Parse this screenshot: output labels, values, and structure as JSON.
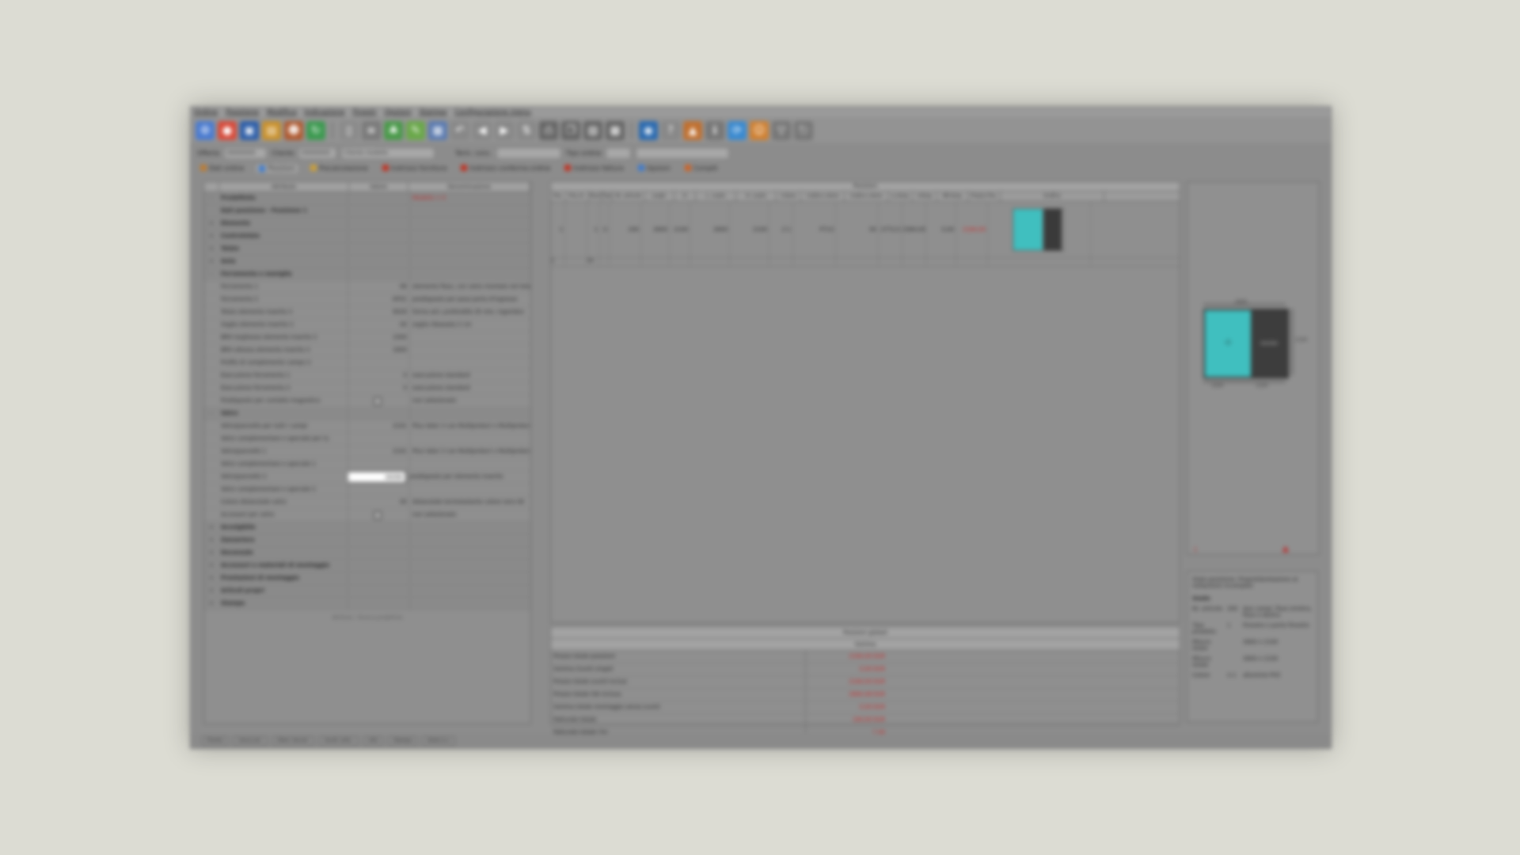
{
  "menu": [
    "Ordine",
    "Posizione",
    "Modifica",
    "Indicazione",
    "Finestr",
    "Opzioni",
    "Stampa",
    "Configurazione menu"
  ],
  "header": {
    "offerta_label": "Offerta",
    "offerta_value": "00000000",
    "cliente_label": "Cliente",
    "cliente_id": "00000000",
    "cliente_name": "Cliente modello",
    "term_label": "Term. cons.",
    "tipo_label": "Tipo ordine"
  },
  "tabs": [
    "Dati ordine",
    "Posizioni",
    "Precalcolazione",
    "Indirizzo fornitura",
    "Indirizzo conferma ordine",
    "Indirizzo fattura",
    "Opzioni",
    "Compiti"
  ],
  "left_grid": {
    "headers": [
      "Attributo",
      "Valore",
      "Denominazione"
    ],
    "rows": [
      {
        "t": "group",
        "exp": "-",
        "name": "Predefinito",
        "val": "",
        "den": "Modello = 0"
      },
      {
        "t": "group",
        "exp": "",
        "name": "Dati posizione - Posizione 1",
        "val": "",
        "den": ""
      },
      {
        "t": "group",
        "exp": "+",
        "name": "Elemento",
        "val": "",
        "den": ""
      },
      {
        "t": "group",
        "exp": "+",
        "name": "Controtelaio",
        "val": "",
        "den": ""
      },
      {
        "t": "group",
        "exp": "+",
        "name": "Telaio",
        "val": "",
        "den": ""
      },
      {
        "t": "group",
        "exp": "+",
        "name": "Anta",
        "val": "",
        "den": ""
      },
      {
        "t": "group",
        "exp": "-",
        "name": "Ferramenta e maniglia",
        "val": "",
        "den": ""
      },
      {
        "t": "row",
        "exp": "",
        "name": "Ferramenta 1",
        "val": "99",
        "den": "elemento fisso, con vetro montato nel telaio"
      },
      {
        "t": "row",
        "exp": "",
        "name": "Ferramenta 2",
        "val": "HF01",
        "den": "predisposto per posa porta d'ingresso"
      },
      {
        "t": "row",
        "exp": "",
        "name": "Telaio elemento inserito 2",
        "val": "9029",
        "den": "forma ad L profondità 35 mm, ingombro"
      },
      {
        "t": "row",
        "exp": "",
        "name": "Soglia elemento inserito 2",
        "val": "00",
        "den": "soglia ribassata 2 cm"
      },
      {
        "t": "row",
        "exp": "",
        "name": "BRH larghezza elemento inserito 2",
        "val": "1000",
        "den": ""
      },
      {
        "t": "row",
        "exp": "",
        "name": "BRH altezza elemento inserito 2",
        "val": "1600",
        "den": ""
      },
      {
        "t": "row",
        "exp": "",
        "name": "Profilo di complemento campo 2",
        "val": "",
        "den": ""
      },
      {
        "t": "row",
        "exp": "",
        "name": "Esecuzione ferramenta 1",
        "val": "0",
        "den": "esecuzione standard"
      },
      {
        "t": "row",
        "exp": "",
        "name": "Esecuzione ferramenta 2",
        "val": "0",
        "den": "esecuzione standard"
      },
      {
        "t": "check",
        "exp": "",
        "name": "Predisposto per contatto magnetico",
        "val": "",
        "den": "non selezionato"
      },
      {
        "t": "group",
        "exp": "-",
        "name": "Vetro",
        "val": "",
        "den": ""
      },
      {
        "t": "row",
        "exp": "",
        "name": "Vetro/pannello per tutti i campi",
        "val": "2101",
        "den": "Plus Valor 2 con Multiprotect x Multiprotect"
      },
      {
        "t": "row",
        "exp": "",
        "name": "Vetro complementare o speciale per tu",
        "val": "",
        "den": ""
      },
      {
        "t": "row",
        "exp": "",
        "name": "Vetro/pannello 1",
        "val": "2101",
        "den": "Plus Valor 2 con Multiprotect x Multiprotect"
      },
      {
        "t": "row",
        "exp": "",
        "name": "Vetro complementare o speciale 1",
        "val": "",
        "den": ""
      },
      {
        "t": "edit",
        "exp": "",
        "name": "Vetro/pannello 2",
        "val": "00090",
        "den": "predisposto per elemento inserito"
      },
      {
        "t": "row",
        "exp": "",
        "name": "Vetro complementare o speciale 2",
        "val": "",
        "den": ""
      },
      {
        "t": "row",
        "exp": "",
        "name": "Colore distanziale vetro",
        "val": "00",
        "den": "distanziale termoisolante colore nero 00"
      },
      {
        "t": "check",
        "exp": "",
        "name": "Accessori per vetro",
        "val": "",
        "den": "non selezionato"
      },
      {
        "t": "group",
        "exp": "+",
        "name": "Avvolgibile",
        "val": "",
        "den": ""
      },
      {
        "t": "group",
        "exp": "+",
        "name": "Zanzariera",
        "val": "",
        "den": ""
      },
      {
        "t": "group",
        "exp": "+",
        "name": "Davanzale",
        "val": "",
        "den": ""
      },
      {
        "t": "group",
        "exp": "+",
        "name": "Accessori e materiali di montaggio",
        "val": "",
        "den": ""
      },
      {
        "t": "group",
        "exp": "+",
        "name": "Prestazioni di montaggio",
        "val": "",
        "den": ""
      },
      {
        "t": "group",
        "exp": "+",
        "name": "Articoli propri",
        "val": "",
        "den": ""
      },
      {
        "t": "group",
        "exp": "+",
        "name": "Stampa",
        "val": "",
        "den": ""
      }
    ],
    "footer": "Attributo - Ricerca predefinita"
  },
  "positions": {
    "title": "Posizioni",
    "headers": [
      "Pos.",
      "Pos.cli.",
      "Pezzi",
      "Tipo",
      "Nr. articolo",
      "Largh.",
      "H",
      "L. vuoto",
      "H. vuoto",
      "Colore",
      "Codice colore",
      "Codice colore",
      "Lv.Arqu",
      "V.Arqu",
      "NR.Arqu",
      "Prezzo Pos.",
      "Grafica"
    ],
    "row": [
      "1",
      "",
      "1",
      "U",
      "200",
      "2600",
      "2100",
      "2600",
      "2100",
      "2-1",
      "P713",
      "00",
      "2772,0",
      "2384,00",
      "0,00",
      "2184,00"
    ],
    "row2": [
      "2",
      "",
      "00"
    ]
  },
  "global_title": "Posizioni globali",
  "summary": {
    "title": "Somma",
    "rows": [
      {
        "k": "Prezzo totale posizioni",
        "v": "2184,00 EUR"
      },
      {
        "k": "Somma Sconti singoli",
        "v": "0,00 EUR"
      },
      {
        "k": "Prezzo totale sconti inclusi",
        "v": "2184,00 EUR"
      },
      {
        "k": "Prezzo totale IVA inclusa",
        "v": "2664,48 EUR"
      },
      {
        "k": "Somma totale montaggio senza sconti",
        "v": "0,00 EUR"
      },
      {
        "k": "Fatturato totale",
        "v": "184,00 EUR"
      },
      {
        "k": "Fatturato totale (%)",
        "v": "7,44"
      }
    ]
  },
  "drawing": {
    "top_dim": "2600",
    "left_dim": "2100",
    "bottom_left": "1500",
    "bottom_right": "1100",
    "panel_label": "00090"
  },
  "props": {
    "title": "Stato posizione: Proprietà/relazione al. nella/zione incompleti",
    "section": "Usato",
    "rows": [
      {
        "k": "Nr. articolo",
        "n": "200",
        "v": "due campi, fisso sinistra, fisso a destra"
      },
      {
        "k": "Tipo prodotto",
        "n": "1",
        "v": "Finestre e porte finestre"
      },
      {
        "k": "Misura telaio",
        "n": "",
        "v": "2600 x 2100"
      },
      {
        "k": "Misura totale",
        "n": "",
        "v": "2600 x 2100"
      },
      {
        "k": "Colore",
        "n": "2-1",
        "v": "alluminio PVC"
      }
    ]
  },
  "statusbar": [
    "Pronto",
    "Cerca art.",
    "Elem. tecnol.",
    "Scroll. artic.",
    "Info",
    "Stampa",
    "Aiuto e s."
  ]
}
